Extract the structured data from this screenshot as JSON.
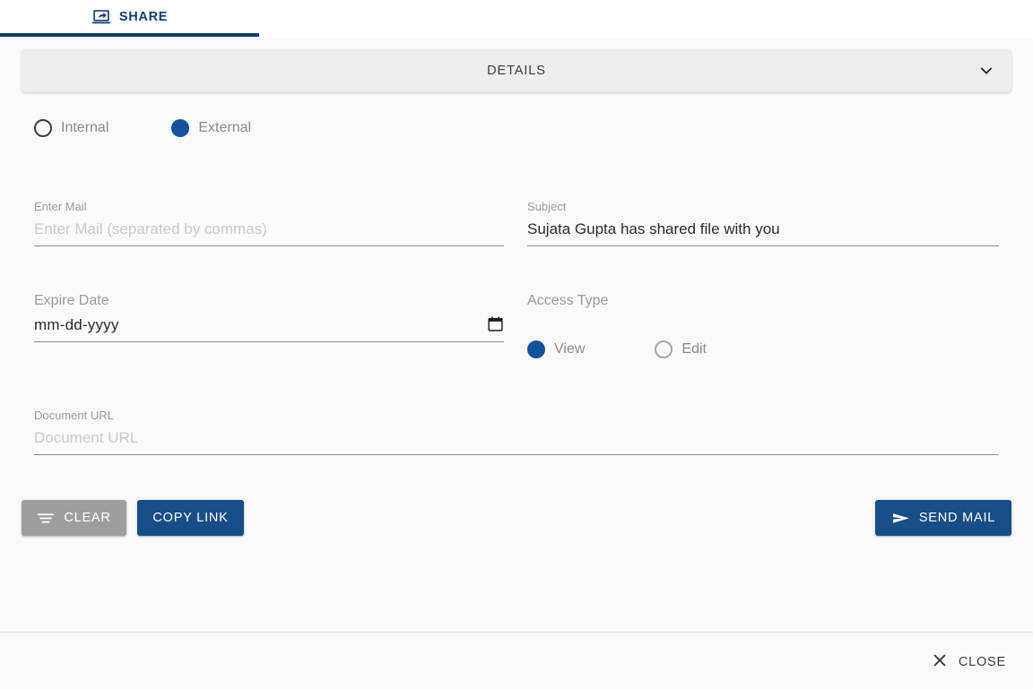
{
  "tab": {
    "label": "SHARE",
    "icon": "screen-share-icon",
    "active": true,
    "accent_color": "#0b3c70"
  },
  "accordion": {
    "title": "DETAILS",
    "expanded": true,
    "chevron_icon": "chevron-down-icon",
    "background": "#eeeeee"
  },
  "share_scope": {
    "options": [
      {
        "label": "Internal",
        "selected": false
      },
      {
        "label": "External",
        "selected": true
      }
    ],
    "selected": "External",
    "selected_color": "#14529c"
  },
  "form": {
    "enter_mail": {
      "label": "Enter Mail",
      "placeholder": "Enter Mail (separated by commas)",
      "value": ""
    },
    "subject": {
      "label": "Subject",
      "placeholder": "",
      "value": "Sujata Gupta has shared file with you"
    },
    "expire_date": {
      "label": "Expire Date",
      "placeholder": "mm-dd-yyyy",
      "value": "",
      "picker_icon": "calendar-icon"
    },
    "access_type": {
      "label": "Access Type",
      "options": [
        {
          "label": "View",
          "selected": true
        },
        {
          "label": "Edit",
          "selected": false
        }
      ],
      "selected": "View"
    },
    "document_url": {
      "label": "Document URL",
      "placeholder": "Document URL",
      "value": ""
    }
  },
  "actions": {
    "clear": {
      "label": "CLEAR",
      "icon": "clear-lines-icon",
      "color": "#9e9e9e"
    },
    "copy_link": {
      "label": "COPY LINK",
      "color": "#174e88"
    },
    "send_mail": {
      "label": "SEND MAIL",
      "icon": "send-paper-plane-icon",
      "color": "#174e88"
    }
  },
  "footer": {
    "close": {
      "label": "CLOSE",
      "icon": "close-x-icon"
    }
  }
}
